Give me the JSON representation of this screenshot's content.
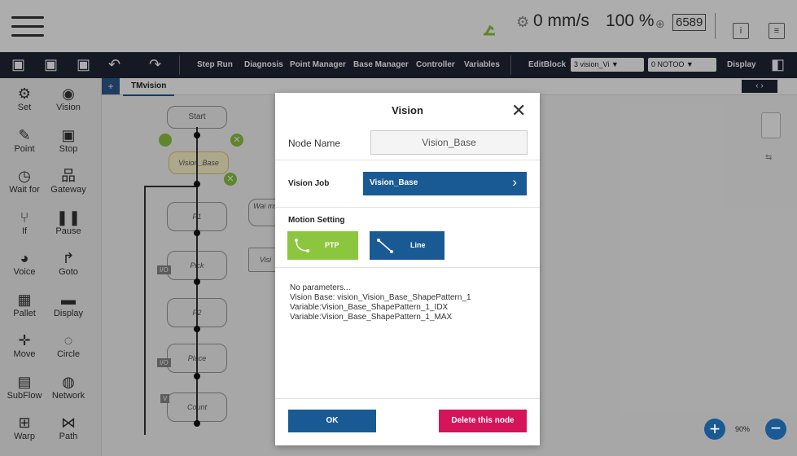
{
  "status": {
    "speed": "0 mm/s",
    "percent": "100 %",
    "counter": "6589"
  },
  "toolbar": {
    "items": [
      "Step Run",
      "Diagnosis",
      "Point Manager",
      "Base Manager",
      "Controller",
      "Variables",
      "EditBlock"
    ],
    "select1": "3 vision_Vi ▼",
    "select2": "0 NOTOO ▼",
    "display": "Display"
  },
  "sidebar": {
    "items": [
      {
        "label": "Set",
        "icon": "set-icon"
      },
      {
        "label": "Vision",
        "icon": "eye-icon"
      },
      {
        "label": "Point",
        "icon": "point-icon"
      },
      {
        "label": "Stop",
        "icon": "stop-icon"
      },
      {
        "label": "Wait for",
        "icon": "clock-icon"
      },
      {
        "label": "Gateway",
        "icon": "gateway-icon"
      },
      {
        "label": "If",
        "icon": "if-icon"
      },
      {
        "label": "Pause",
        "icon": "pause-icon"
      },
      {
        "label": "Voice",
        "icon": "voice-icon"
      },
      {
        "label": "Goto",
        "icon": "goto-icon"
      },
      {
        "label": "Pallet",
        "icon": "pallet-icon"
      },
      {
        "label": "Display",
        "icon": "display-icon"
      },
      {
        "label": "Move",
        "icon": "move-icon"
      },
      {
        "label": "Circle",
        "icon": "circle-icon"
      },
      {
        "label": "SubFlow",
        "icon": "subflow-icon"
      },
      {
        "label": "Network",
        "icon": "network-icon"
      },
      {
        "label": "Warp",
        "icon": "warp-icon"
      },
      {
        "label": "Path",
        "icon": "path-icon"
      }
    ]
  },
  "canvas": {
    "tab": "TMvision",
    "nodes": {
      "start": "Start",
      "vision": "Vision_Base",
      "p1": "P1",
      "pick": "Pick",
      "p2": "P2",
      "place": "Place",
      "count": "Count",
      "wait": "Wai ms",
      "vis2": "Visi"
    },
    "io1": "I/O",
    "io2": "I/O",
    "v": "V"
  },
  "dialog": {
    "title": "Vision",
    "node_name_label": "Node Name",
    "node_name_value": "Vision_Base",
    "vision_job_label": "Vision Job",
    "vision_job_value": "Vision_Base",
    "motion_label": "Motion Setting",
    "ptp_label": "PTP",
    "line_label": "Line",
    "info": [
      "No parameters...",
      "Vision Base: vision_Vision_Base_ShapePattern_1",
      "Variable:Vision_Base_ShapePattern_1_IDX",
      "Variable:Vision_Base_ShapePattern_1_MAX"
    ],
    "ok_label": "OK",
    "delete_label": "Delete this node"
  },
  "zoom": "90%",
  "colors": {
    "primary": "#1a5a94",
    "ptp_green": "#8cc63f",
    "delete_pink": "#d6145a",
    "toolbar_bg": "#1e2535"
  }
}
